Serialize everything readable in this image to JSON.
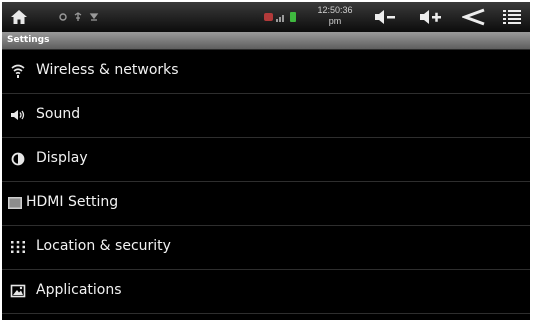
{
  "statusbar": {
    "time": "12:50:36",
    "ampm": "pm",
    "icons": [
      "home-icon",
      "notification-icons",
      "signal-battery-icons",
      "volume-down-icon",
      "volume-up-icon",
      "back-icon",
      "menu-icon"
    ]
  },
  "titlebar": {
    "title": "Settings"
  },
  "settings": {
    "items": [
      {
        "label": "Wireless & networks",
        "icon": "wifi-icon"
      },
      {
        "label": "Sound",
        "icon": "speaker-icon"
      },
      {
        "label": "Display",
        "icon": "display-icon"
      },
      {
        "label": "HDMI Setting",
        "icon": "hdmi-icon"
      },
      {
        "label": "Location & security",
        "icon": "location-grid-icon"
      },
      {
        "label": "Applications",
        "icon": "applications-icon"
      }
    ]
  },
  "colors": {
    "background": "#000000",
    "text": "#f2f2f2",
    "divider": "#2e2e2e",
    "titlebar": "#7a7a7a"
  }
}
